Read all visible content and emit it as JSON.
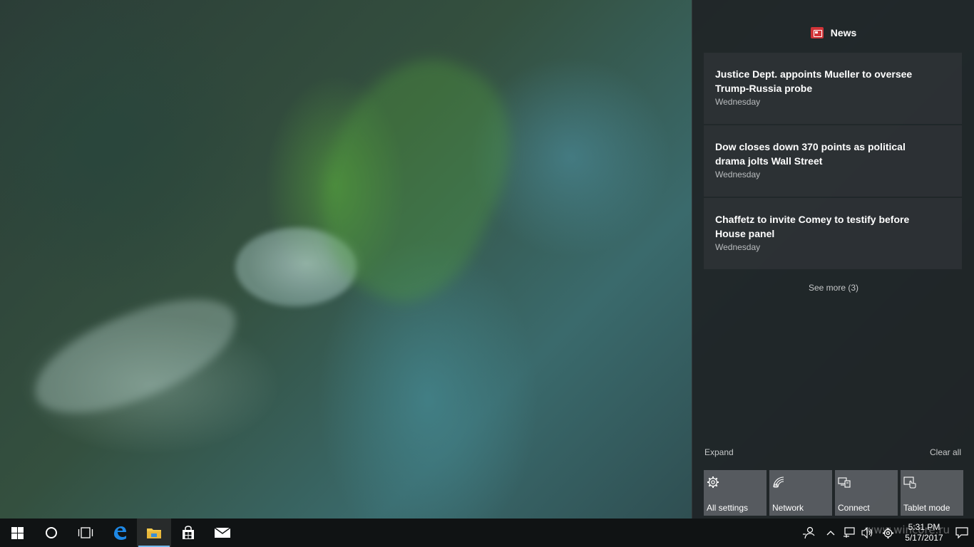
{
  "action_center": {
    "news_title": "News",
    "cards": [
      {
        "title": "Justice Dept. appoints Mueller to oversee Trump-Russia probe",
        "time": "Wednesday"
      },
      {
        "title": "Dow closes down 370 points as political drama jolts Wall Street",
        "time": "Wednesday"
      },
      {
        "title": "Chaffetz to invite Comey to testify before House panel",
        "time": "Wednesday"
      }
    ],
    "see_more": "See more (3)",
    "expand": "Expand",
    "clear_all": "Clear all",
    "quick_actions": [
      {
        "label": "All settings",
        "icon": "gear-icon"
      },
      {
        "label": "Network",
        "icon": "network-icon"
      },
      {
        "label": "Connect",
        "icon": "connect-icon"
      },
      {
        "label": "Tablet mode",
        "icon": "tablet-mode-icon"
      }
    ]
  },
  "taskbar": {
    "apps": [
      "start",
      "cortana",
      "task-view",
      "edge",
      "file-explorer",
      "store",
      "mail"
    ],
    "clock_time": "5:31 PM",
    "clock_date": "5/17/2017"
  },
  "watermark": "www.wincore.ru",
  "colors": {
    "news_accent": "#d13438",
    "taskbar_highlight": "#76b9ed",
    "edge_blue": "#1e88e5",
    "explorer_yellow": "#f2c84b"
  }
}
